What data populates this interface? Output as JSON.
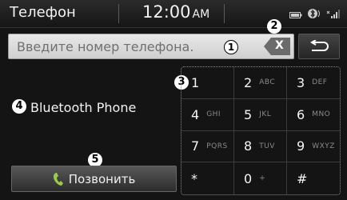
{
  "status_bar": {
    "title": "Телефон",
    "time": "12:00",
    "ampm": "AM",
    "icons": [
      "battery-icon",
      "bluetooth-icon",
      "signal-icon"
    ]
  },
  "input": {
    "placeholder": "Введите номер телефона.",
    "clear_label": "X"
  },
  "device_name": "Bluetooth Phone",
  "call_button": {
    "label": "Позвонить"
  },
  "callouts": [
    "1",
    "2",
    "3",
    "4",
    "5"
  ],
  "keypad": [
    {
      "digit": "1",
      "letters": ""
    },
    {
      "digit": "2",
      "letters": "ABC"
    },
    {
      "digit": "3",
      "letters": "DEF"
    },
    {
      "digit": "4",
      "letters": "GHI"
    },
    {
      "digit": "5",
      "letters": "JKL"
    },
    {
      "digit": "6",
      "letters": "MNO"
    },
    {
      "digit": "7",
      "letters": "PQRS"
    },
    {
      "digit": "8",
      "letters": "TUV"
    },
    {
      "digit": "9",
      "letters": "WXYZ"
    },
    {
      "digit": "*",
      "letters": ""
    },
    {
      "digit": "0",
      "letters": "+"
    },
    {
      "digit": "#",
      "letters": ""
    }
  ]
}
